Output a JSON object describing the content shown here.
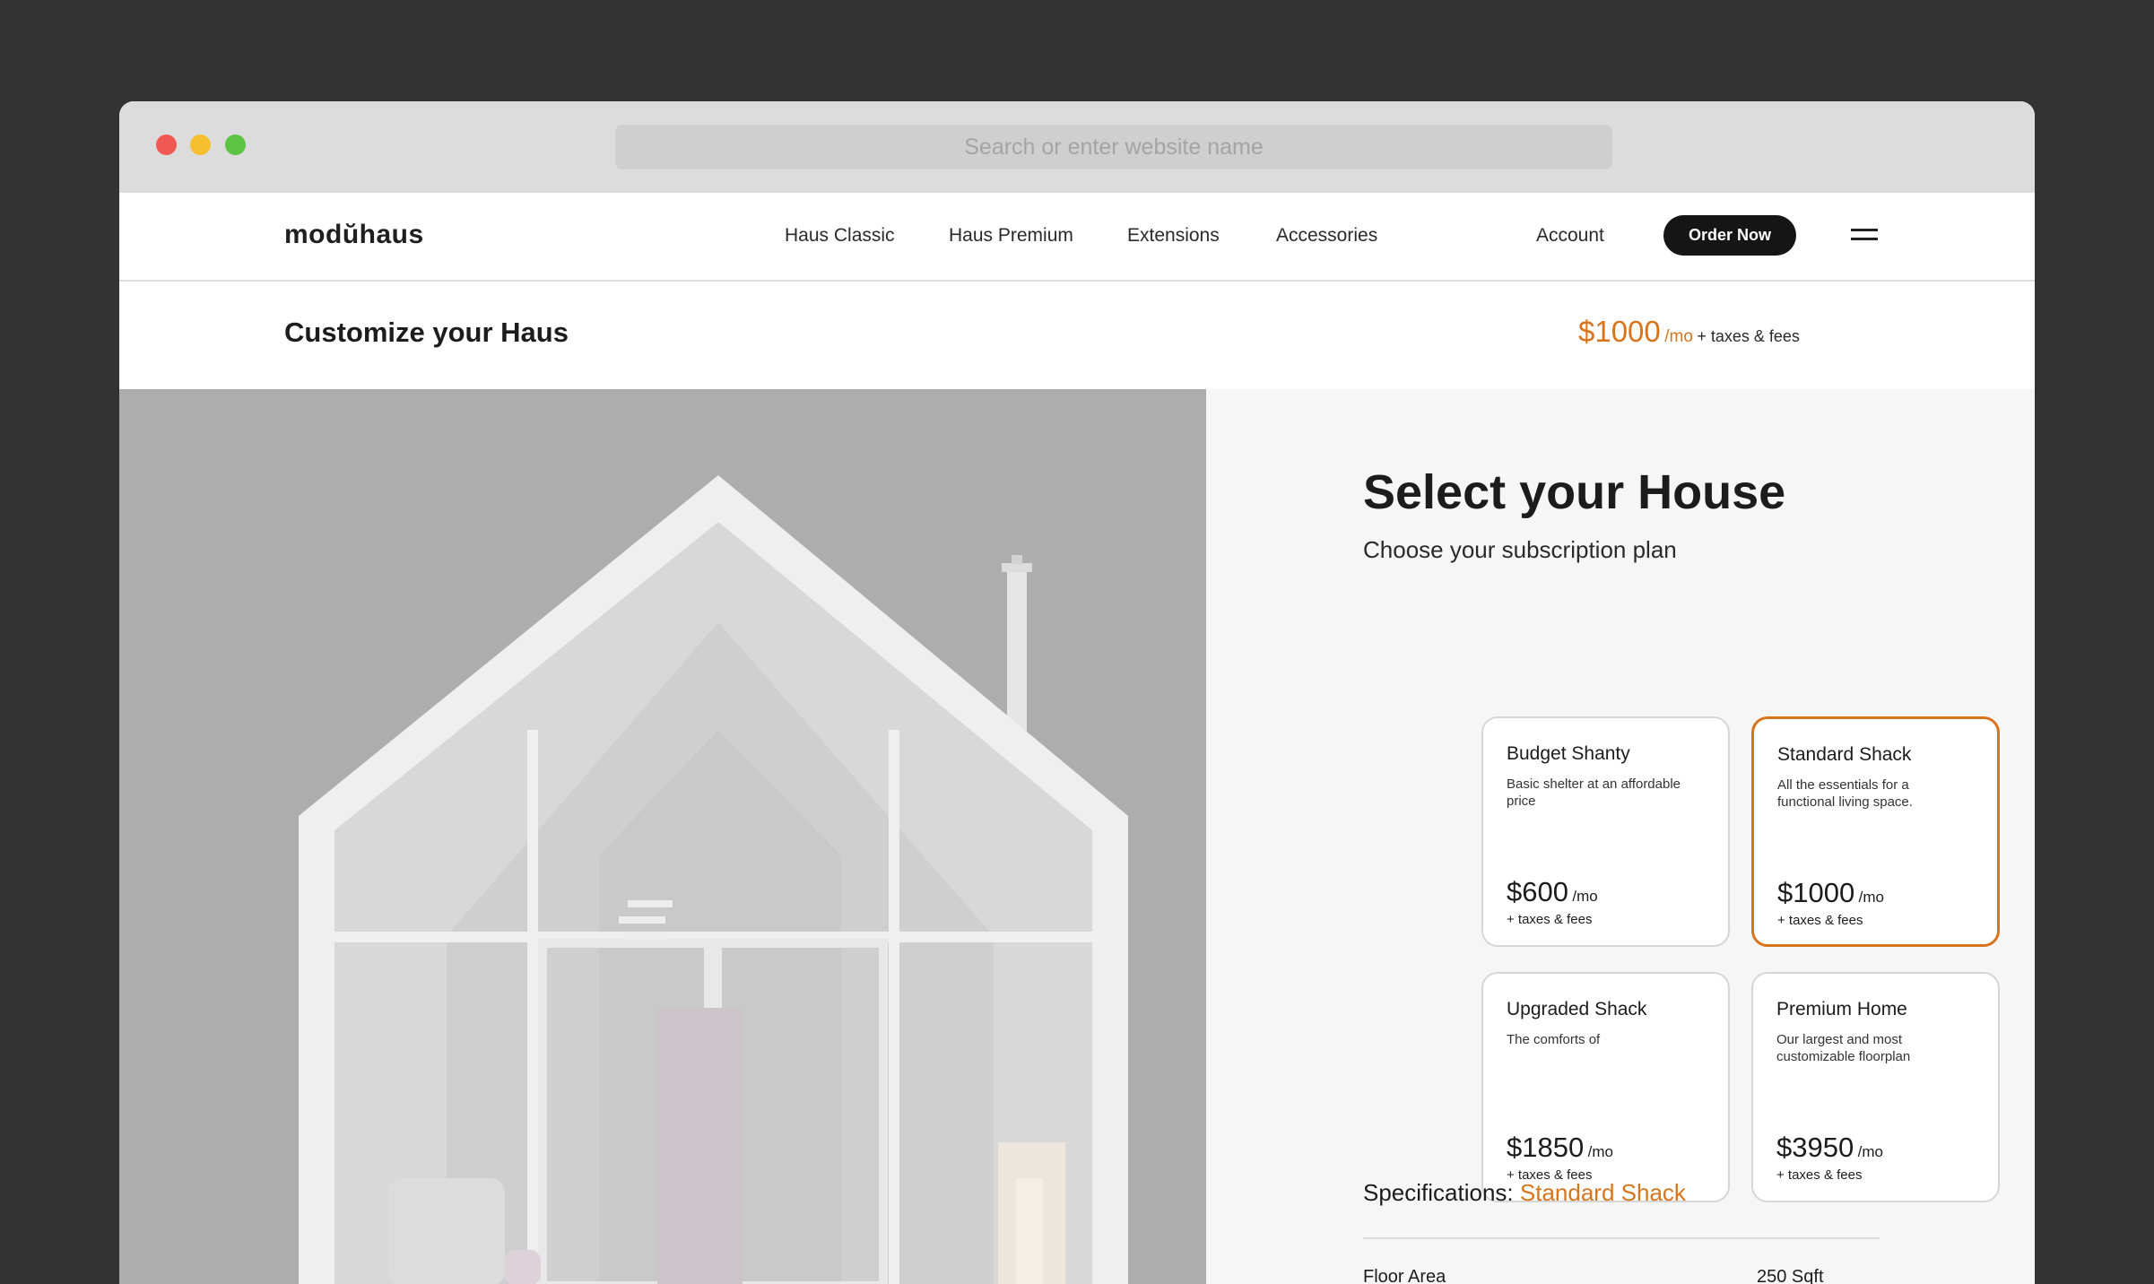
{
  "browser": {
    "url_placeholder": "Search or enter website name"
  },
  "nav": {
    "logo": "modŭhaus",
    "links": [
      "Haus Classic",
      "Haus Premium",
      "Extensions",
      "Accessories"
    ],
    "account": "Account",
    "order_button": "Order Now",
    "menu_icon": "hamburger-icon"
  },
  "header": {
    "title": "Customize your Haus",
    "price": "$1000",
    "price_unit": "/mo",
    "fees": "+ taxes & fees"
  },
  "panel": {
    "title": "Select your House",
    "subtitle": "Choose your subscription plan",
    "plans": [
      {
        "name": "Budget Shanty",
        "desc": "Basic shelter at an affordable price",
        "price": "$600",
        "unit": "/mo",
        "fees": "+ taxes & fees",
        "selected": false
      },
      {
        "name": "Standard Shack",
        "desc": "All the essentials for a functional living space.",
        "price": "$1000",
        "unit": "/mo",
        "fees": "+ taxes & fees",
        "selected": true
      },
      {
        "name": "Upgraded Shack",
        "desc": "The comforts of",
        "price": "$1850",
        "unit": "/mo",
        "fees": "+ taxes & fees",
        "selected": false
      },
      {
        "name": "Premium Home",
        "desc": "Our largest and most customizable floorplan",
        "price": "$3950",
        "unit": "/mo",
        "fees": "+ taxes & fees",
        "selected": false
      }
    ],
    "specs": {
      "label": "Specifications:",
      "selected_plan": "Standard Shack",
      "rows": [
        {
          "label": "Floor Area",
          "value": "250 Sqft"
        }
      ]
    }
  },
  "colors": {
    "accent": "#d8741c",
    "page_bg": "#333333",
    "panel_bg": "#f6f6f6"
  }
}
